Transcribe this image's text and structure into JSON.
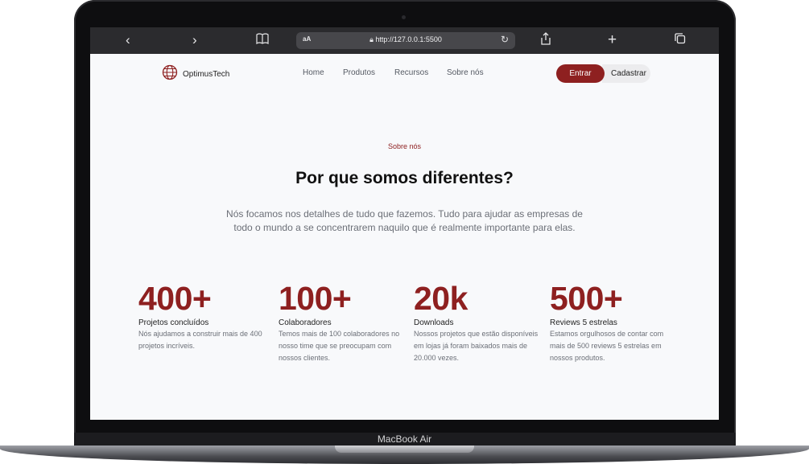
{
  "device": {
    "label": "MacBook Air"
  },
  "browser": {
    "aa_label": "aA",
    "url": "http://127.0.0.1:5500",
    "back_glyph": "‹",
    "forward_glyph": "›",
    "bookmarks_glyph": "⊞",
    "share_glyph": "⇧",
    "new_tab_glyph": "+",
    "tabs_glyph": "⧉",
    "reload_glyph": "↻"
  },
  "nav": {
    "brand": "OptimusTech",
    "links": [
      "Home",
      "Produtos",
      "Recursos",
      "Sobre nós"
    ],
    "login_label": "Entrar",
    "signup_label": "Cadastrar"
  },
  "hero": {
    "eyebrow": "Sobre nós",
    "title": "Por que somos diferentes?",
    "lead": "Nós focamos nos detalhes de tudo que fazemos. Tudo para ajudar as empresas de todo o mundo a se concentrarem naquilo que é realmente importante para elas."
  },
  "stats": [
    {
      "value": "400+",
      "title": "Projetos concluídos",
      "desc": "Nós ajudamos a construir mais de 400 projetos incríveis."
    },
    {
      "value": "100+",
      "title": "Colaboradores",
      "desc": "Temos mais de 100 colaboradores no nosso time que se preocupam com nossos clientes."
    },
    {
      "value": "20k",
      "title": "Downloads",
      "desc": "Nossos projetos que estão disponíveis em lojas já foram baixados mais de 20.000 vezes."
    },
    {
      "value": "500+",
      "title": "Reviews 5 estrelas",
      "desc": "Estamos orgulhosos de contar com mais de 500 reviews 5 estrelas em nossos produtos."
    }
  ],
  "colors": {
    "accent": "#8e2020",
    "background": "#f8f9fb",
    "text": "#111111",
    "muted": "#6b6f77"
  }
}
